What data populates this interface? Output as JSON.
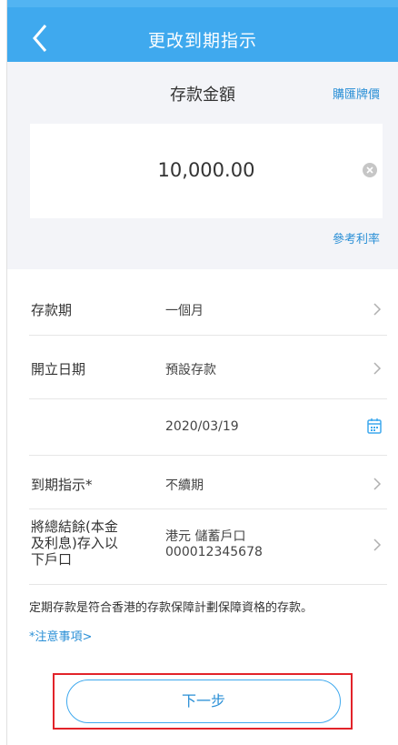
{
  "header": {
    "title": "更改到期指示"
  },
  "amount_section": {
    "label": "存款金額",
    "fx_link": "購匯牌價",
    "amount_value": "10,000.00",
    "rate_link": "參考利率"
  },
  "form": {
    "rows": [
      {
        "label": "存款期",
        "value": "一個月"
      },
      {
        "label": "開立日期",
        "value": "預設存款"
      },
      {
        "label": "",
        "value": "2020/03/19"
      },
      {
        "label": "到期指示*",
        "value": "不續期"
      },
      {
        "label_lines": [
          "將總結餘(本金",
          "及利息)存入以",
          "下戶口"
        ],
        "value_lines": [
          "港元 儲蓄戶口",
          "000012345678"
        ]
      }
    ]
  },
  "note": "定期存款是符合香港的存款保障計劃保障資格的存款。",
  "notice_link": "*注意事項>",
  "next_button": "下一步",
  "colors": {
    "header": "#3fa9ee",
    "link": "#2a8fd6",
    "highlight": "#e2232a"
  },
  "icons": [
    "back-arrow-icon",
    "clear-icon",
    "chevron-right-icon",
    "calendar-icon"
  ]
}
